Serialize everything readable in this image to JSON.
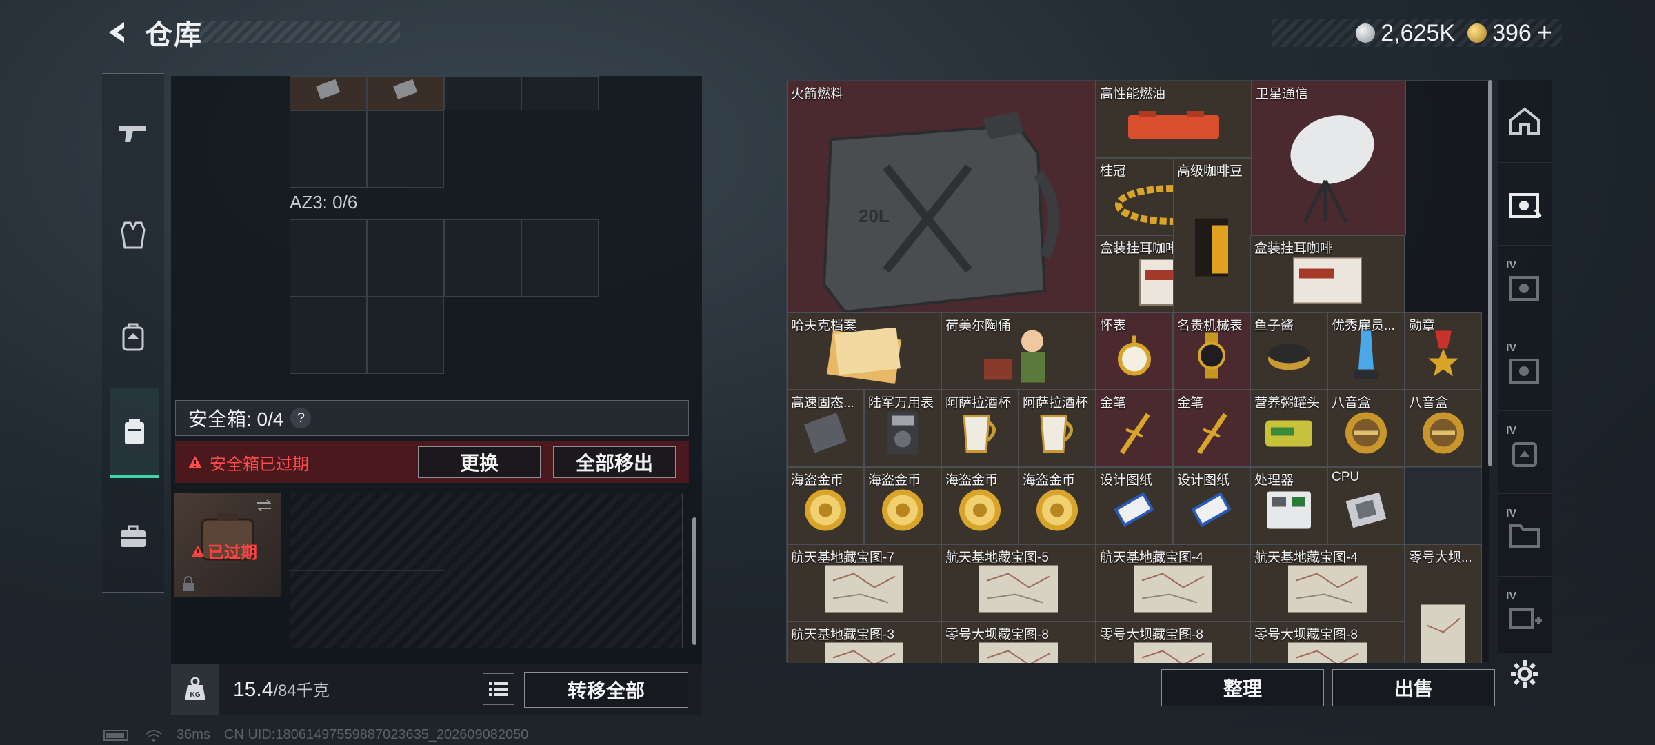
{
  "header": {
    "title": "仓库"
  },
  "currency": {
    "silver": "2,625K",
    "gold": "396",
    "plus": "+"
  },
  "left_panel": {
    "az3_label": "AZ3: 0/6",
    "safe_box_title": "安全箱: 0/4",
    "help": "?",
    "expired_notice": "安全箱已过期",
    "replace_btn": "更换",
    "move_all_btn": "全部移出",
    "case_status": "已过期",
    "weight_current": "15.4",
    "weight_max": "/84千克",
    "weight_icon_label": "KG",
    "transfer_all_btn": "转移全部"
  },
  "stash": {
    "items": [
      {
        "name": "火箭燃料"
      },
      {
        "name": "高性能燃油"
      },
      {
        "name": "卫星通信"
      },
      {
        "name": "桂冠"
      },
      {
        "name": "高级咖啡豆"
      },
      {
        "name": "盒装挂耳咖啡"
      },
      {
        "name": "盒装挂耳咖啡"
      },
      {
        "name": "哈夫克档案"
      },
      {
        "name": "荷美尔陶俑"
      },
      {
        "name": "怀表"
      },
      {
        "name": "名贵机械表"
      },
      {
        "name": "鱼子酱"
      },
      {
        "name": "优秀雇员..."
      },
      {
        "name": "勋章"
      },
      {
        "name": "高速固态..."
      },
      {
        "name": "陆军万用表"
      },
      {
        "name": "阿萨拉酒杯"
      },
      {
        "name": "阿萨拉酒杯"
      },
      {
        "name": "金笔"
      },
      {
        "name": "金笔"
      },
      {
        "name": "营养粥罐头"
      },
      {
        "name": "八音盒"
      },
      {
        "name": "八音盒"
      },
      {
        "name": "海盗金币"
      },
      {
        "name": "海盗金币"
      },
      {
        "name": "海盗金币"
      },
      {
        "name": "海盗金币"
      },
      {
        "name": "设计图纸"
      },
      {
        "name": "设计图纸"
      },
      {
        "name": "处理器"
      },
      {
        "name": "CPU"
      },
      {
        "name": "航天基地藏宝图-7"
      },
      {
        "name": "航天基地藏宝图-5"
      },
      {
        "name": "航天基地藏宝图-4"
      },
      {
        "name": "航天基地藏宝图-4"
      },
      {
        "name": "零号大坝..."
      },
      {
        "name": "航天基地藏宝图-3"
      },
      {
        "name": "零号大坝藏宝图-8"
      },
      {
        "name": "零号大坝藏宝图-8"
      },
      {
        "name": "零号大坝藏宝图-8"
      }
    ],
    "sort_btn": "整理",
    "sell_btn": "出售"
  },
  "right_rail": {
    "tier_label": "IV"
  },
  "status": {
    "ping": "36ms",
    "uid": "CN UID:1806149755988702363​5_202609082050"
  },
  "colors": {
    "accent": "#3fd8a3",
    "danger": "#ff4d4d",
    "item_red": "#4a2a2e"
  }
}
